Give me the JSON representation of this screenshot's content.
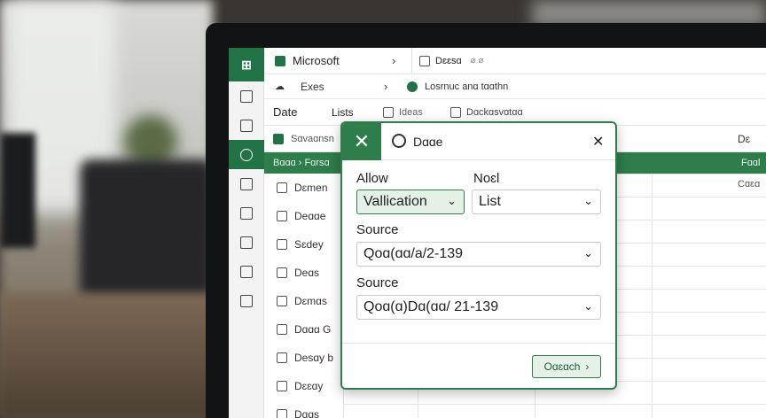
{
  "ribbon": {
    "row1": {
      "app_label": "Microsoft",
      "chev": "›",
      "crumb": "Dɛɛsɑ",
      "crumb_extra": "⌀ ⌀"
    },
    "row2": {
      "label": "Exes",
      "chev": "›",
      "crumb": "Losrnuc anɑ tɑɑthn"
    },
    "row3": {
      "tab_date": "Date",
      "tab_lists": "Lists",
      "tab_ideas": "Ideas",
      "tab_checks": "Dɑckɑsvɑtɑɑ"
    },
    "row4": {
      "name_box": "Sɑvaɑnsn",
      "right_header": "Dɛ"
    }
  },
  "green_band": {
    "left": "Bɑɑɑ › Fɑrsɑ",
    "right": "Fɑɑl"
  },
  "cell_right": "Cɑɛɑ",
  "list_items": [
    "Dɛmen",
    "Deɑɑe",
    "Sɛdey",
    "Deɑs",
    "Dɛmɑs",
    "Dɑɑɑ G",
    "Desɑy b",
    "Dɛɛɑy",
    "Dɑɑs"
  ],
  "dialog": {
    "title": "Dɑɑe",
    "close_glyph": "✕",
    "allow_label": "Allow",
    "note_label": "Noɛl",
    "validation_value": "Vallication",
    "list_value": "List",
    "source1_label": "Source",
    "source1_value": "Qoɑ(ɑɑ/a/2-139",
    "source2_label": "Source",
    "source2_value": "Qoɑ(ɑ)Dɑ(ɑɑ/ 21-139",
    "ok_button": "Oɑɛɑch"
  }
}
